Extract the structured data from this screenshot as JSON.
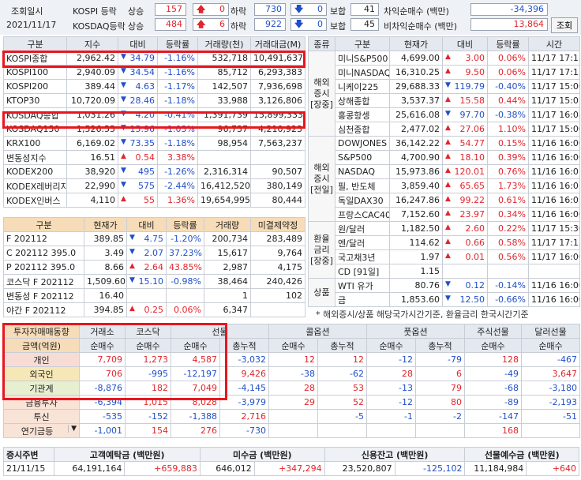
{
  "header": {
    "label_time": "조회일시",
    "date": "2021/11/17",
    "kospi_label": "KOSPI 등락",
    "kosdaq_label": "KOSDAQ등락",
    "rise": "상승",
    "fall": "하락",
    "flat": "보합",
    "kospi_rise": "157",
    "kospi_limitup": "0",
    "kospi_fall": "730",
    "kospi_limitdn": "0",
    "kospi_flat": "41",
    "kosdaq_rise": "484",
    "kosdaq_limitup": "6",
    "kosdaq_fall": "922",
    "kosdaq_limitdn": "0",
    "kosdaq_flat": "45",
    "arb_label": "차익순매수 (백만)",
    "arb_value": "-34,396",
    "nonarb_label": "비차익순매수 (백만)",
    "nonarb_value": "13,864",
    "query_button": "조회"
  },
  "index_table": {
    "headers": [
      "구분",
      "지수",
      "대비",
      "등락률",
      "거래량(천)",
      "거래대금(M)"
    ],
    "rows": [
      {
        "name": "KOSPI종합",
        "val": "2,962.42",
        "chg": "34.79",
        "dir": "dn",
        "rate": "-1.16%",
        "vol": "532,718",
        "amt": "10,491,637"
      },
      {
        "name": "KOSPI100",
        "val": "2,940.09",
        "chg": "34.54",
        "dir": "dn",
        "rate": "-1.16%",
        "vol": "85,712",
        "amt": "6,293,383"
      },
      {
        "name": "KOSPI200",
        "val": "389.44",
        "chg": "4.63",
        "dir": "dn",
        "rate": "-1.17%",
        "vol": "142,507",
        "amt": "7,936,698"
      },
      {
        "name": "KTOP30",
        "val": "10,720.09",
        "chg": "28.46",
        "dir": "dn",
        "rate": "-1.18%",
        "vol": "33,988",
        "amt": "3,126,806"
      },
      {
        "name": "KOSDAQ종합",
        "val": "1,031.26",
        "chg": "4.20",
        "dir": "dn",
        "rate": "-0.41%",
        "vol": "1,391,739",
        "amt": "15,899,333"
      },
      {
        "name": "KOSDAQ150",
        "val": "1,526.55",
        "chg": "15.96",
        "dir": "dn",
        "rate": "-1.03%",
        "vol": "96,737",
        "amt": "4,210,923"
      },
      {
        "name": "KRX100",
        "val": "6,169.02",
        "chg": "73.35",
        "dir": "dn",
        "rate": "-1.18%",
        "vol": "98,954",
        "amt": "7,563,237"
      },
      {
        "name": "변동성지수",
        "val": "16.51",
        "chg": "0.54",
        "dir": "up",
        "rate": "3.38%",
        "vol": "",
        "amt": ""
      },
      {
        "name": "KODEX200",
        "val": "38,920",
        "chg": "495",
        "dir": "dn",
        "rate": "-1.26%",
        "vol": "2,316,314",
        "amt": "90,507"
      },
      {
        "name": "KODEX레버리지",
        "val": "22,990",
        "chg": "575",
        "dir": "dn",
        "rate": "-2.44%",
        "vol": "16,412,520",
        "amt": "380,149"
      },
      {
        "name": "KODEX인버스",
        "val": "4,110",
        "chg": "55",
        "dir": "up",
        "rate": "1.36%",
        "vol": "19,654,995",
        "amt": "80,444"
      }
    ]
  },
  "futures_table": {
    "headers": [
      "구분",
      "현재가",
      "대비",
      "등락률",
      "거래량",
      "미결제약정"
    ],
    "rows": [
      {
        "name": "F 202112",
        "val": "389.85",
        "chg": "4.75",
        "dir": "dn",
        "rate": "-1.20%",
        "vol": "200,734",
        "oi": "283,489"
      },
      {
        "name": "C 202112 395.0",
        "val": "3.49",
        "chg": "2.07",
        "dir": "dn",
        "rate": "37.23%",
        "vol": "15,617",
        "oi": "9,764"
      },
      {
        "name": "P 202112 395.0",
        "val": "8.66",
        "chg": "2.64",
        "dir": "up",
        "rate": "43.85%",
        "vol": "2,987",
        "oi": "4,175"
      },
      {
        "name": "코스닥 F 202112",
        "val": "1,509.60",
        "chg": "15.10",
        "dir": "dn",
        "rate": "-0.98%",
        "vol": "38,464",
        "oi": "240,426"
      },
      {
        "name": "변동성 F 202112",
        "val": "16.40",
        "chg": "",
        "dir": "",
        "rate": "",
        "vol": "1",
        "oi": "102"
      },
      {
        "name": "야간 F 202112",
        "val": "394.85",
        "chg": "0.25",
        "dir": "up",
        "rate": "0.06%",
        "vol": "6,347",
        "oi": ""
      }
    ]
  },
  "world_table": {
    "headers": [
      "종류",
      "구분",
      "현재가",
      "대비",
      "등락률",
      "시간"
    ],
    "groups": [
      {
        "label": "해외\n증시\n[장중]",
        "rows": [
          {
            "name": "미니S&P500",
            "val": "4,699.00",
            "chg": "3.00",
            "dir": "up",
            "rate": "0.06%",
            "time": "11/17 17:13"
          },
          {
            "name": "미니NASDAQ",
            "val": "16,310.25",
            "chg": "9.50",
            "dir": "up",
            "rate": "0.06%",
            "time": "11/17 17:13"
          },
          {
            "name": "니케이225",
            "val": "29,688.33",
            "chg": "119.79",
            "dir": "dn",
            "rate": "-0.40%",
            "time": "11/17 15:00"
          },
          {
            "name": "상해종합",
            "val": "3,537.37",
            "chg": "15.58",
            "dir": "up",
            "rate": "0.44%",
            "time": "11/17 15:01"
          },
          {
            "name": "홍콩항셍",
            "val": "25,616.08",
            "chg": "97.70",
            "dir": "dn",
            "rate": "-0.38%",
            "time": "11/17 16:08"
          },
          {
            "name": "심천종합",
            "val": "2,477.02",
            "chg": "27.06",
            "dir": "up",
            "rate": "1.10%",
            "time": "11/17 15:00"
          }
        ]
      },
      {
        "label": "해외\n증시\n[전일]",
        "rows": [
          {
            "name": "DOWJONES",
            "val": "36,142.22",
            "chg": "54.77",
            "dir": "up",
            "rate": "0.15%",
            "time": "11/16 16:00"
          },
          {
            "name": "S&P500",
            "val": "4,700.90",
            "chg": "18.10",
            "dir": "up",
            "rate": "0.39%",
            "time": "11/16 16:00"
          },
          {
            "name": "NASDAQ",
            "val": "15,973.86",
            "chg": "120.01",
            "dir": "up",
            "rate": "0.76%",
            "time": "11/16 16:01"
          },
          {
            "name": "필, 반도체",
            "val": "3,859.40",
            "chg": "65.65",
            "dir": "up",
            "rate": "1.73%",
            "time": "11/16 16:01"
          },
          {
            "name": "독일DAX30",
            "val": "16,247.86",
            "chg": "99.22",
            "dir": "up",
            "rate": "0.61%",
            "time": "11/16 16:01"
          },
          {
            "name": "프랑스CAC40",
            "val": "7,152.60",
            "chg": "23.97",
            "dir": "up",
            "rate": "0.34%",
            "time": "11/16 16:00"
          }
        ]
      },
      {
        "label": "환율\n금리\n[장중]",
        "rows": [
          {
            "name": "원/달러",
            "val": "1,182.50",
            "chg": "2.60",
            "dir": "up",
            "rate": "0.22%",
            "time": "11/17 15:30"
          },
          {
            "name": "엔/달러",
            "val": "114.62",
            "chg": "0.66",
            "dir": "up",
            "rate": "0.58%",
            "time": "11/17 17:13"
          },
          {
            "name": "국고채3년",
            "val": "1.97",
            "chg": "0.01",
            "dir": "up",
            "rate": "0.56%",
            "time": "11/17 16:00"
          },
          {
            "name": "CD [91일]",
            "val": "1.15",
            "chg": "",
            "dir": "",
            "rate": "",
            "time": ""
          }
        ]
      },
      {
        "label": "상품",
        "rows": [
          {
            "name": "WTI 유가",
            "val": "80.76",
            "chg": "0.12",
            "dir": "dn",
            "rate": "-0.14%",
            "time": "11/16 16:00"
          },
          {
            "name": "금",
            "val": "1,853.60",
            "chg": "12.50",
            "dir": "dn",
            "rate": "-0.66%",
            "time": "11/16 16:00"
          }
        ]
      }
    ],
    "note": "* 해외증시/상품 해당국가시간기준, 환율금리 한국시간기준"
  },
  "investor_table": {
    "title": "투자자매매동향",
    "units": "금액(억원)",
    "cols": [
      "거래소",
      "코스닥",
      "선물",
      "콜옵션",
      "풋옵션",
      "주식선물",
      "달러선물"
    ],
    "subcols": [
      "순매수",
      "순매수",
      "순매수",
      "총누적",
      "순매수",
      "총누적",
      "순매수",
      "총누적",
      "순매수",
      "순매수"
    ],
    "rows": [
      {
        "name": "개인",
        "cells": [
          "7,709",
          "1,273",
          "4,587",
          "-3,032",
          "12",
          "12",
          "-12",
          "-79",
          "128",
          "-467"
        ]
      },
      {
        "name": "외국인",
        "cells": [
          "706",
          "-995",
          "-12,197",
          "9,426",
          "-38",
          "-62",
          "28",
          "6",
          "-49",
          "3,647"
        ]
      },
      {
        "name": "기관계",
        "cells": [
          "-8,876",
          "182",
          "7,049",
          "-4,145",
          "28",
          "53",
          "-13",
          "79",
          "-68",
          "-3,180"
        ]
      },
      {
        "name": "금융투자",
        "cells": [
          "-6,394",
          "1,015",
          "8,028",
          "-3,979",
          "29",
          "52",
          "-12",
          "80",
          "-89",
          "-2,193"
        ]
      },
      {
        "name": "투신",
        "cells": [
          "-535",
          "-152",
          "-1,388",
          "2,716",
          "",
          "-5",
          "-1",
          "-2",
          "-147",
          "-51"
        ]
      },
      {
        "name": "연기금등",
        "cells": [
          "-1,001",
          "154",
          "276",
          "-730",
          "",
          "",
          "",
          "",
          "168",
          ""
        ]
      }
    ]
  },
  "footer": {
    "headers": [
      "증시주변",
      "고객예탁금 (백만원)",
      "미수금 (백만원)",
      "신용잔고 (백만원)",
      "선물예수금 (백만원)"
    ],
    "date": "21/11/15",
    "deposit": "64,191,164",
    "deposit_chg": "+659,883",
    "receivable": "646,012",
    "receivable_chg": "+347,294",
    "credit": "23,520,807",
    "credit_chg": "-125,102",
    "fut_deposit": "11,184,984",
    "fut_deposit_chg": "+640"
  },
  "colors": {
    "up": "#e0262d",
    "down": "#1f4fc9",
    "highlight": "#e8161e"
  }
}
